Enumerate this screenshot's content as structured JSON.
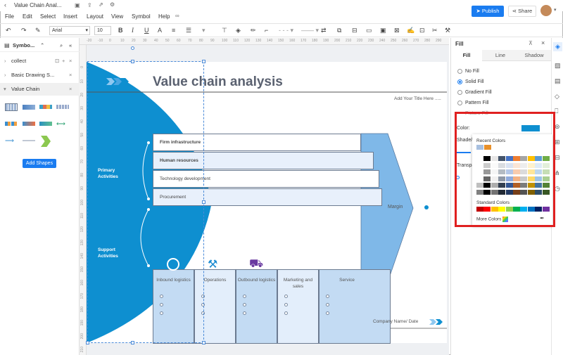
{
  "app": {
    "title": "Value Chain Anal..."
  },
  "menu": [
    "File",
    "Edit",
    "Select",
    "Insert",
    "Layout",
    "View",
    "Symbol",
    "Help"
  ],
  "header": {
    "publish_label": "Publish",
    "share_label": "Share"
  },
  "toolbar": {
    "font": "Arial",
    "size": "10"
  },
  "left_panel": {
    "title": "Symbo...",
    "items": [
      {
        "label": "collect"
      },
      {
        "label": "Basic Drawing S..."
      },
      {
        "label": "Value Chain"
      }
    ],
    "add_shapes_label": "Add Shapes"
  },
  "ruler": {
    "top": [
      "-20",
      "-10",
      "0",
      "10",
      "20",
      "30",
      "40",
      "50",
      "60",
      "70",
      "80",
      "90",
      "100",
      "110",
      "120",
      "130",
      "140",
      "150",
      "160",
      "170",
      "180",
      "190",
      "200",
      "210",
      "220",
      "230",
      "240",
      "250",
      "260",
      "270",
      "280",
      "290"
    ],
    "left": [
      "0",
      "10",
      "20",
      "30",
      "40",
      "50",
      "60",
      "70",
      "80",
      "90",
      "100",
      "110",
      "120",
      "130",
      "140",
      "150",
      "160",
      "170",
      "180",
      "190",
      "200",
      "210"
    ]
  },
  "diagram": {
    "title": "Value chain analysis",
    "subtitle": "Add Your Title Here .....",
    "primary_label": "Primary Activities",
    "support_label": "Support Activities",
    "bars": [
      "Firm infrastructure",
      "Human resources",
      "Technology development",
      "Procurement"
    ],
    "columns": [
      "Inbound logistics",
      "Operations",
      "Outbound logistics",
      "Marketing and sales",
      "Service"
    ],
    "margin_label": "Margin",
    "footer": "Company Name/ Date"
  },
  "fill_panel": {
    "title": "Fill",
    "tabs": [
      "Fill",
      "Line",
      "Shadow"
    ],
    "options": [
      "No Fill",
      "Solid Fill",
      "Gradient Fill",
      "Pattern Fill",
      "Picture Fill"
    ],
    "selected_option": "Solid Fill",
    "color_label": "Color:",
    "shade_label": "Shade/T",
    "transparency_label": "Transpa",
    "color_value": "#0e8fd0"
  },
  "color_popup": {
    "recent_label": "Recent Colors",
    "recent": [
      "#a8c0e0",
      "#e8902a"
    ],
    "standard_label": "Standard Colors",
    "standard": [
      "#c00000",
      "#ff0000",
      "#ffc000",
      "#ffff00",
      "#92d050",
      "#00b050",
      "#00b0f0",
      "#0070c0",
      "#002060",
      "#7030a0"
    ],
    "more_label": "More Colors",
    "theme_top": [
      "#ffffff",
      "#000000",
      "#e7e6e6",
      "#44546a",
      "#4472c4",
      "#ed7d31",
      "#a5a5a5",
      "#ffc000",
      "#5b9bd5",
      "#70ad47"
    ]
  },
  "colors": {
    "accent": "#1a7cf0",
    "diagram_blue": "#0e8fd0",
    "highlight": "#e02020"
  }
}
